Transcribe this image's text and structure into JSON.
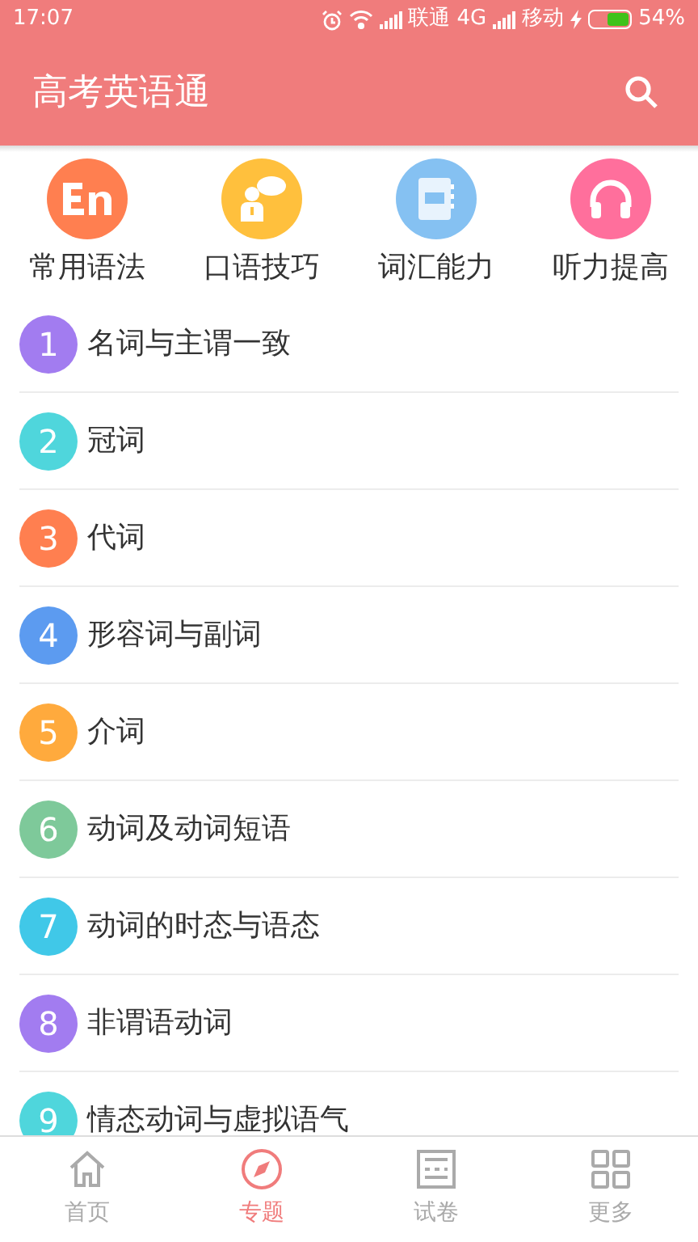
{
  "status_bar": {
    "time": "17:07",
    "carrier_1": "联通",
    "network_1": "4G",
    "carrier_2": "移动",
    "battery": "54%"
  },
  "header": {
    "title": "高考英语通"
  },
  "categories": [
    {
      "kind": "en",
      "label": "常用语法",
      "color": "#ff7f50"
    },
    {
      "kind": "speak",
      "label": "口语技巧",
      "color": "#ffc03d"
    },
    {
      "kind": "book",
      "label": "词汇能力",
      "color": "#85c1f2"
    },
    {
      "kind": "headphones",
      "label": "听力提高",
      "color": "#ff6f9c"
    }
  ],
  "topics": [
    {
      "number": "1",
      "title": "名词与主谓一致",
      "color": "#a27cf0"
    },
    {
      "number": "2",
      "title": "冠词",
      "color": "#4fd6dc"
    },
    {
      "number": "3",
      "title": "代词",
      "color": "#ff7f50"
    },
    {
      "number": "4",
      "title": "形容词与副词",
      "color": "#5c9bf0"
    },
    {
      "number": "5",
      "title": "介词",
      "color": "#ffaa3d"
    },
    {
      "number": "6",
      "title": "动词及动词短语",
      "color": "#7ec99a"
    },
    {
      "number": "7",
      "title": "动词的时态与语态",
      "color": "#40c8e8"
    },
    {
      "number": "8",
      "title": "非谓语动词",
      "color": "#a27cf0"
    },
    {
      "number": "9",
      "title": "情态动词与虚拟语气",
      "color": "#4fd6dc"
    }
  ],
  "bottom_nav": [
    {
      "kind": "home",
      "label": "首页",
      "selected": false
    },
    {
      "kind": "compass",
      "label": "专题",
      "selected": true
    },
    {
      "kind": "exam",
      "label": "试卷",
      "selected": false
    },
    {
      "kind": "grid",
      "label": "更多",
      "selected": false
    }
  ]
}
